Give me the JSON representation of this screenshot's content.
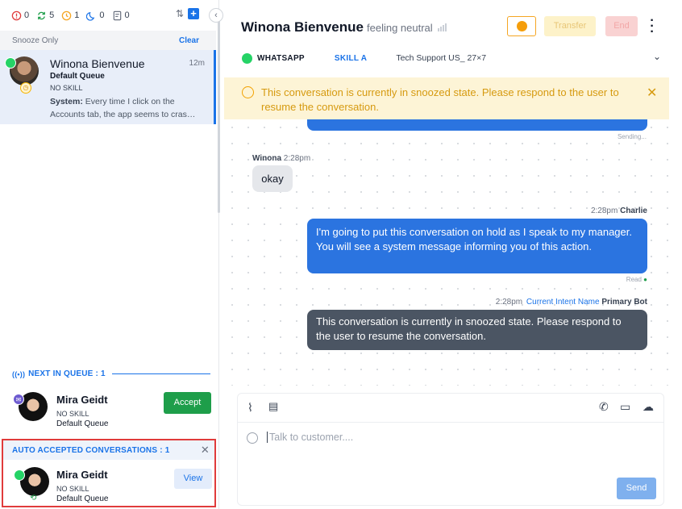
{
  "counters": [
    {
      "icon": "alert-circle-icon",
      "value": "0",
      "color": "#e03b3b"
    },
    {
      "icon": "sync-icon",
      "value": "5",
      "color": "#1e9e4a"
    },
    {
      "icon": "snooze-icon",
      "value": "1",
      "color": "#f5a623"
    },
    {
      "icon": "moon-icon",
      "value": "0",
      "color": "#1a73e8"
    },
    {
      "icon": "note-icon",
      "value": "0",
      "color": "#6b7280"
    }
  ],
  "snooze_filter": {
    "label": "Snooze Only",
    "clear": "Clear"
  },
  "active_conversation": {
    "name": "Winona Bienvenue",
    "time": "12m",
    "queue": "Default Queue",
    "skill": "NO SKILL",
    "preview_label": "System:",
    "preview_text": "Every time I click on the Accounts tab, the app seems to cras…"
  },
  "next_in_queue": {
    "label": "NEXT IN QUEUE : 1",
    "name": "Mira Geidt",
    "skill": "NO SKILL",
    "queue": "Default Queue",
    "accept": "Accept"
  },
  "auto_accepted": {
    "label": "AUTO ACCEPTED CONVERSATIONS : 1",
    "name": "Mira Geidt",
    "skill": "NO SKILL",
    "queue": "Default Queue",
    "view": "View"
  },
  "header": {
    "customer_name": "Winona Bienvenue",
    "sentiment": "feeling neutral",
    "transfer": "Transfer",
    "end": "End",
    "channel": "WHATSAPP",
    "skill": "SKILL A",
    "queue": "Tech Support US_ 27×7"
  },
  "banner": {
    "text": "This conversation is currently in snoozed state. Please respond to the user to resume the conversation."
  },
  "messages": {
    "sending_status": "Sending...",
    "customer_sender": "Winona",
    "customer_time": "2:28pm",
    "customer_text": "okay",
    "agent_time": "2:28pm",
    "agent_sender": "Charlie",
    "agent_text": "I'm going to put this conversation on hold as I speak to my manager. You will see a system message informing you of this action.",
    "read_status": "Read",
    "bot_time": "2:28pm",
    "bot_intent": "Current Intent Name",
    "bot_sender": "Primary Bot",
    "bot_text": "This conversation is currently in snoozed state. Please respond to the user to resume the conversation."
  },
  "composer": {
    "placeholder": "Talk to customer....",
    "send": "Send"
  },
  "colors": {
    "accent": "#1a73e8",
    "accept_green": "#1e9e4a",
    "banner_bg": "#fdf4d6",
    "outgoing_bubble": "#2b74e0",
    "bot_bubble": "#4b5563",
    "highlight_border": "#e03b3b"
  }
}
